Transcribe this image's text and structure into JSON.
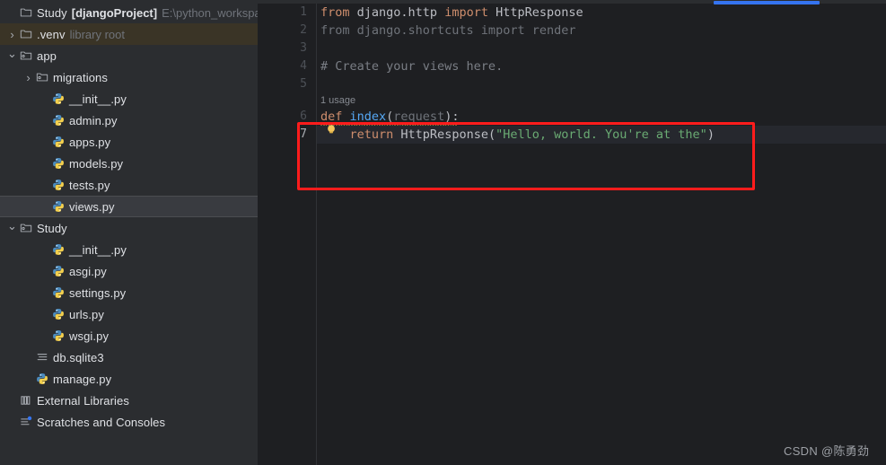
{
  "sidebar": {
    "items": [
      {
        "indent": 0,
        "arrow": "",
        "icon": "folder-icon",
        "label": "Study",
        "bold_label": "[djangoProject]",
        "suffix": "E:\\python_workspa",
        "state": "none"
      },
      {
        "indent": 0,
        "arrow": "›",
        "icon": "folder-icon",
        "label": ".venv",
        "suffix": "library root",
        "state": "olive"
      },
      {
        "indent": 0,
        "arrow": "⌄",
        "icon": "module-folder-icon",
        "label": "app",
        "suffix": "",
        "state": "none"
      },
      {
        "indent": 1,
        "arrow": "›",
        "icon": "module-folder-icon",
        "label": "migrations",
        "suffix": "",
        "state": "none"
      },
      {
        "indent": 2,
        "arrow": "",
        "icon": "python-file-icon",
        "label": "__init__.py",
        "suffix": "",
        "state": "none"
      },
      {
        "indent": 2,
        "arrow": "",
        "icon": "python-file-icon",
        "label": "admin.py",
        "suffix": "",
        "state": "none"
      },
      {
        "indent": 2,
        "arrow": "",
        "icon": "python-file-icon",
        "label": "apps.py",
        "suffix": "",
        "state": "none"
      },
      {
        "indent": 2,
        "arrow": "",
        "icon": "python-file-icon",
        "label": "models.py",
        "suffix": "",
        "state": "none"
      },
      {
        "indent": 2,
        "arrow": "",
        "icon": "python-file-icon",
        "label": "tests.py",
        "suffix": "",
        "state": "none"
      },
      {
        "indent": 2,
        "arrow": "",
        "icon": "python-file-icon",
        "label": "views.py",
        "suffix": "",
        "state": "selected"
      },
      {
        "indent": 0,
        "arrow": "⌄",
        "icon": "module-folder-icon",
        "label": "Study",
        "suffix": "",
        "state": "none"
      },
      {
        "indent": 2,
        "arrow": "",
        "icon": "python-file-icon",
        "label": "__init__.py",
        "suffix": "",
        "state": "none"
      },
      {
        "indent": 2,
        "arrow": "",
        "icon": "python-file-icon",
        "label": "asgi.py",
        "suffix": "",
        "state": "none"
      },
      {
        "indent": 2,
        "arrow": "",
        "icon": "python-file-icon",
        "label": "settings.py",
        "suffix": "",
        "state": "none"
      },
      {
        "indent": 2,
        "arrow": "",
        "icon": "python-file-icon",
        "label": "urls.py",
        "suffix": "",
        "state": "none"
      },
      {
        "indent": 2,
        "arrow": "",
        "icon": "python-file-icon",
        "label": "wsgi.py",
        "suffix": "",
        "state": "none"
      },
      {
        "indent": 1,
        "arrow": "",
        "icon": "database-file-icon",
        "label": "db.sqlite3",
        "suffix": "",
        "state": "none"
      },
      {
        "indent": 1,
        "arrow": "",
        "icon": "python-file-icon",
        "label": "manage.py",
        "suffix": "",
        "state": "none"
      },
      {
        "indent": 0,
        "arrow": "",
        "icon": "library-icon",
        "label": "External Libraries",
        "suffix": "",
        "state": "none"
      },
      {
        "indent": 0,
        "arrow": "",
        "icon": "scratches-icon",
        "label": "Scratches and Consoles",
        "suffix": "",
        "state": "none"
      }
    ]
  },
  "editor": {
    "line_numbers": [
      "1",
      "2",
      "3",
      "4",
      "5",
      "6",
      "7"
    ],
    "current_line": "7",
    "usage_hint": "1 usage",
    "code_lines": [
      {
        "n": 1,
        "tokens": [
          {
            "t": "from ",
            "c": "kw"
          },
          {
            "t": "django.http ",
            "c": "pln"
          },
          {
            "t": "import ",
            "c": "kw"
          },
          {
            "t": "HttpResponse",
            "c": "pln"
          }
        ]
      },
      {
        "n": 2,
        "tokens": [
          {
            "t": "from django.shortcuts import render",
            "c": "gray"
          }
        ]
      },
      {
        "n": 3,
        "tokens": []
      },
      {
        "n": 4,
        "tokens": [
          {
            "t": "# Create your views here.",
            "c": "cmt"
          }
        ]
      },
      {
        "n": 5,
        "tokens": []
      },
      {
        "n": 6,
        "tokens": [
          {
            "t": "def ",
            "c": "kw"
          },
          {
            "t": "index",
            "c": "fn"
          },
          {
            "t": "(",
            "c": "par"
          },
          {
            "t": "request",
            "c": "gray"
          },
          {
            "t": "):",
            "c": "par"
          }
        ]
      },
      {
        "n": 7,
        "tokens": [
          {
            "t": "    ",
            "c": "pln"
          },
          {
            "t": "return ",
            "c": "kw"
          },
          {
            "t": "HttpResponse",
            "c": "pln"
          },
          {
            "t": "(",
            "c": "par"
          },
          {
            "t": "\"Hello, world. You're at the\"",
            "c": "str"
          },
          {
            "t": ")",
            "c": "par"
          }
        ]
      }
    ],
    "quick_fix_icon": "lightbulb-icon",
    "annotation_box": "red-highlight-box"
  },
  "watermark": {
    "text": "CSDN @陈勇劲"
  },
  "colors": {
    "sidebar_bg": "#2B2D30",
    "editor_bg": "#1E1F22",
    "accent_blue": "#3574F0",
    "keyword_orange": "#CF8E6D",
    "function_blue": "#56A8F5",
    "string_green": "#6AAB73",
    "comment_gray": "#7A7E85",
    "annotation_red": "#FF1C1C",
    "selected_row": "#393B40",
    "venv_row": "#3A3426"
  }
}
